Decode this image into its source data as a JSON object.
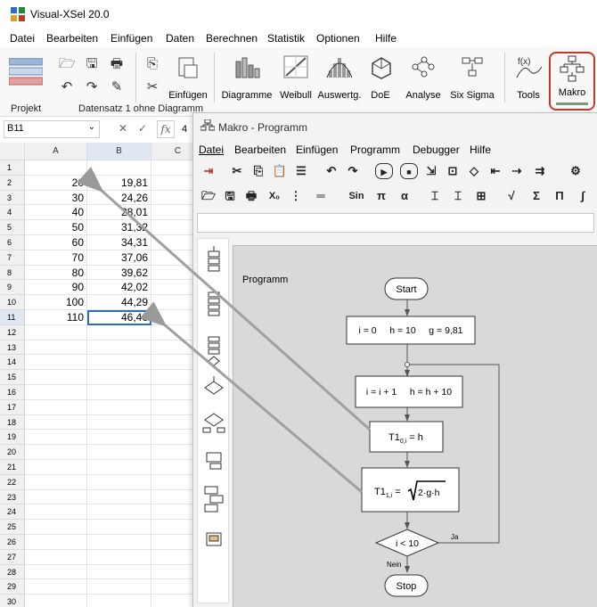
{
  "app": {
    "title": "Visual-XSel 20.0",
    "menu": [
      "Datei",
      "Bearbeiten",
      "Einfügen",
      "Daten",
      "Berechnen",
      "Statistik",
      "Optionen",
      "Hilfe"
    ]
  },
  "ribbon": {
    "buttons": [
      "Einfügen",
      "Diagramme",
      "Weibull",
      "Auswertg.",
      "DoE",
      "Analyse",
      "Six Sigma",
      "Tools",
      "Makro"
    ],
    "group_project": "Projekt",
    "group_dataset": "Datensatz 1 ohne Diagramm",
    "accent_color": "#c0392b"
  },
  "formula_bar": {
    "cell_ref": "B11",
    "fx": "fx",
    "partial_value": "4"
  },
  "sheet": {
    "columns": [
      "A",
      "B",
      "C"
    ],
    "row_numbers": [
      "1",
      "2",
      "3",
      "4",
      "5",
      "6",
      "7",
      "8",
      "9",
      "10",
      "11",
      "12",
      "13",
      "14",
      "15",
      "16",
      "17",
      "18",
      "19",
      "20",
      "21",
      "22",
      "23",
      "24",
      "25",
      "26",
      "27",
      "28",
      "29",
      "30"
    ],
    "col_a": [
      "",
      "20",
      "30",
      "40",
      "50",
      "60",
      "70",
      "80",
      "90",
      "100",
      "110"
    ],
    "col_b": [
      "",
      "19,81",
      "24,26",
      "28,01",
      "31,32",
      "34,31",
      "37,06",
      "39,62",
      "42,02",
      "44,29",
      "46,46"
    ],
    "selected_cell": "B11"
  },
  "macro_window": {
    "title": "Makro - Programm",
    "menu": [
      "Datei",
      "Bearbeiten",
      "Einfügen",
      "Programm",
      "Debugger",
      "Hilfe"
    ],
    "toolbar_text": [
      "Sin",
      "π",
      "α",
      "√",
      "Σ",
      "Π",
      "∫"
    ]
  },
  "flowchart": {
    "label": "Programm",
    "start": "Start",
    "init": "i = 0     h = 10     g = 9,81",
    "increment": "i = i + 1     h = h + 10",
    "assign1": "T1",
    "assign1_sub": "0,i",
    "assign1_rest": " = h",
    "assign2": "T1",
    "assign2_sub": "1,i",
    "assign2_rest": " = ",
    "assign2_sqrt": "2·g·h",
    "condition": "i < 10",
    "yes": "Ja",
    "no": "Nein",
    "stop": "Stop"
  }
}
